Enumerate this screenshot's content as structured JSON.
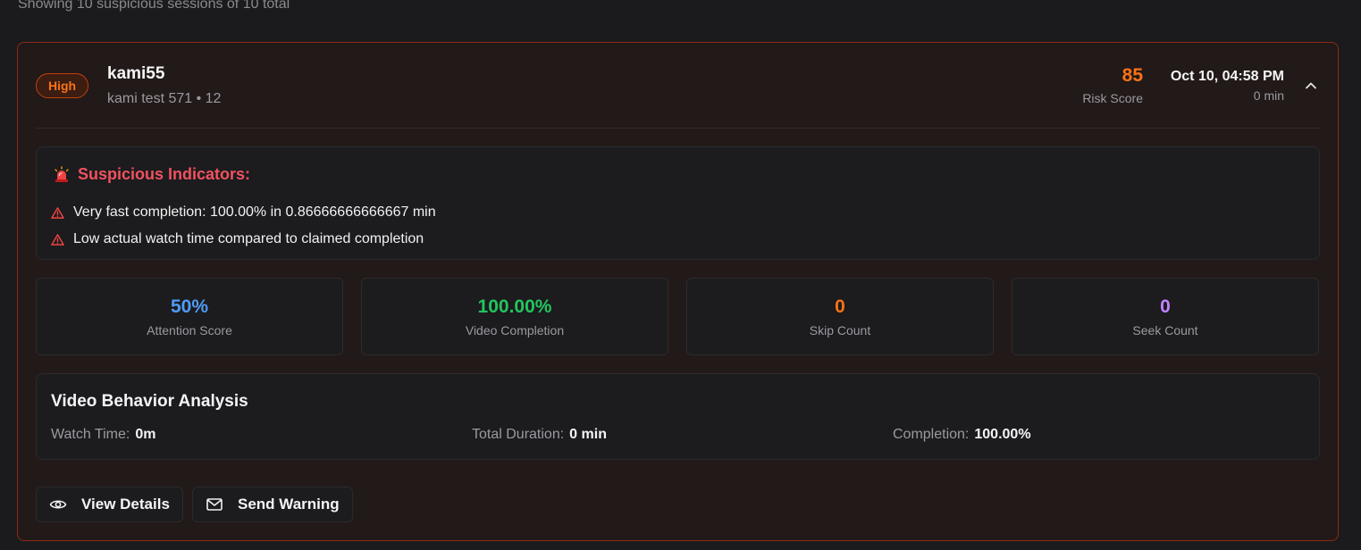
{
  "summary_text": "Showing 10 suspicious sessions of 10 total",
  "session": {
    "severity": "High",
    "username": "kami55",
    "subline": "kami test 571 • 12",
    "risk_score": "85",
    "risk_label": "Risk Score",
    "date": "Oct 10, 04:58 PM",
    "duration": "0 min"
  },
  "indicators": {
    "title": "Suspicious Indicators:",
    "items": [
      "Very fast completion: 100.00% in 0.86666666666667 min",
      "Low actual watch time compared to claimed completion"
    ]
  },
  "stats": [
    {
      "value": "50%",
      "label": "Attention Score",
      "color": "#4f9cf7"
    },
    {
      "value": "100.00%",
      "label": "Video Completion",
      "color": "#22c55e"
    },
    {
      "value": "0",
      "label": "Skip Count",
      "color": "#f97316"
    },
    {
      "value": "0",
      "label": "Seek Count",
      "color": "#c084fc"
    }
  ],
  "behavior": {
    "title": "Video Behavior Analysis",
    "watch_time_label": "Watch Time:",
    "watch_time_value": "0m",
    "total_duration_label": "Total Duration:",
    "total_duration_value": "0 min",
    "completion_label": "Completion:",
    "completion_value": "100.00%"
  },
  "actions": {
    "view_details": "View Details",
    "send_warning": "Send Warning"
  },
  "colors": {
    "accent": "#f97316",
    "danger": "#f0525e",
    "card_border": "#8c2a14"
  },
  "icons": {
    "indicators_title": "siren-icon",
    "indicator_item": "alert-triangle-icon",
    "collapse": "chevron-up-icon",
    "view": "eye-icon",
    "warning": "mail-icon"
  }
}
